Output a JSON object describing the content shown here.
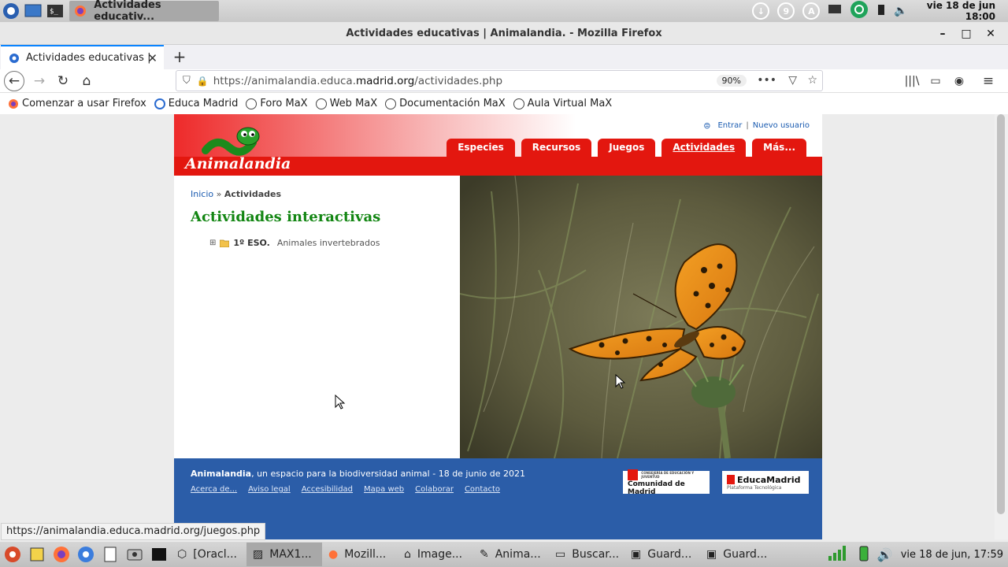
{
  "system_panel": {
    "active_task_title": "Actividades educativ...",
    "tray_badges": [
      "9",
      "A"
    ],
    "clock_date": "vie 18 de jun",
    "clock_time": "18:00"
  },
  "window": {
    "title": "Actividades educativas | Animalandia. - Mozilla Firefox",
    "minimize": "–",
    "maximize": "□",
    "close": "✕"
  },
  "tabs": [
    {
      "label": "Actividades educativas |"
    }
  ],
  "toolbar": {
    "url_prefix": "https://animalandia.educa.",
    "url_host": "madrid.org",
    "url_path": "/actividades.php",
    "zoom": "90%"
  },
  "bookmarks": [
    "Comenzar a usar Firefox",
    "Educa Madrid",
    "Foro MaX",
    "Web MaX",
    "Documentación MaX",
    "Aula Virtual MaX"
  ],
  "site": {
    "logo": "Animalandia",
    "login_link": "Entrar",
    "register_link": "Nuevo usuario",
    "separator": "|",
    "menu": [
      "Especies",
      "Recursos",
      "Juegos",
      "Actividades",
      "Más..."
    ],
    "breadcrumb_home": "Inicio",
    "breadcrumb_sep": "»",
    "breadcrumb_current": "Actividades",
    "page_title": "Actividades interactivas",
    "tree_level": "1º ESO.",
    "tree_desc": "Animales invertebrados",
    "footer_brand": "Animalandia",
    "footer_text": ", un espacio para la biodiversidad animal - 18 de junio de 2021",
    "footer_links": [
      "Acerca de...",
      "Aviso legal",
      "Accesibilidad",
      "Mapa web",
      "Colaborar",
      "Contacto"
    ],
    "logo_comunidad_small": "CONSEJERÍA DE EDUCACIÓN Y JUVENTUD",
    "logo_comunidad": "Comunidad de Madrid",
    "logo_educamadrid": "EducaMadrid",
    "logo_educamadrid_sub": "Plataforma Tecnológica"
  },
  "status_url": "https://animalandia.educa.madrid.org/juegos.php",
  "taskbar": {
    "tasks": [
      "[Oracl...",
      "MAX1...",
      "Mozill...",
      "Image...",
      "Anima...",
      "Buscar...",
      "Guard...",
      "Guard..."
    ],
    "clock": "vie 18 de jun, 17:59"
  },
  "colors": {
    "site_red": "#e3170f",
    "site_green_title": "#138613",
    "site_footer_blue": "#2b5da8",
    "link_blue": "#1a5bb0",
    "firefox_tab_accent": "#0a84ff"
  }
}
